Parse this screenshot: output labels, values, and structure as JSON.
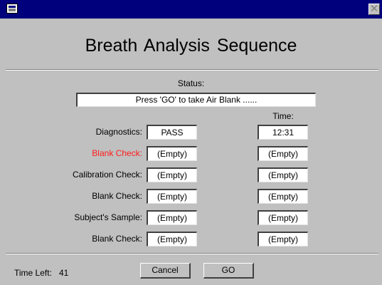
{
  "window": {
    "title": "",
    "system_icon": "window-icon",
    "close_glyph": "✕"
  },
  "heading": "Breath Analysis  Sequence",
  "status": {
    "label": "Status:",
    "value": "Press 'GO' to take Air Blank ......"
  },
  "time_header": "Time:",
  "rows": [
    {
      "label": "Diagnostics:",
      "result": "PASS",
      "time": "12:31",
      "highlight": false
    },
    {
      "label": "Blank Check:",
      "result": "(Empty)",
      "time": "(Empty)",
      "highlight": true
    },
    {
      "label": "Calibration Check:",
      "result": "(Empty)",
      "time": "(Empty)",
      "highlight": false
    },
    {
      "label": "Blank Check:",
      "result": "(Empty)",
      "time": "(Empty)",
      "highlight": false
    },
    {
      "label": "Subject's Sample:",
      "result": "(Empty)",
      "time": "(Empty)",
      "highlight": false
    },
    {
      "label": "Blank Check:",
      "result": "(Empty)",
      "time": "(Empty)",
      "highlight": false
    }
  ],
  "footer": {
    "time_left_label": "Time Left:",
    "time_left_value": "41",
    "cancel_label": "Cancel",
    "go_label": "GO"
  },
  "colors": {
    "titlebar": "#00007c",
    "background": "#c0c0c0",
    "highlight_label": "#ff1a1a"
  }
}
